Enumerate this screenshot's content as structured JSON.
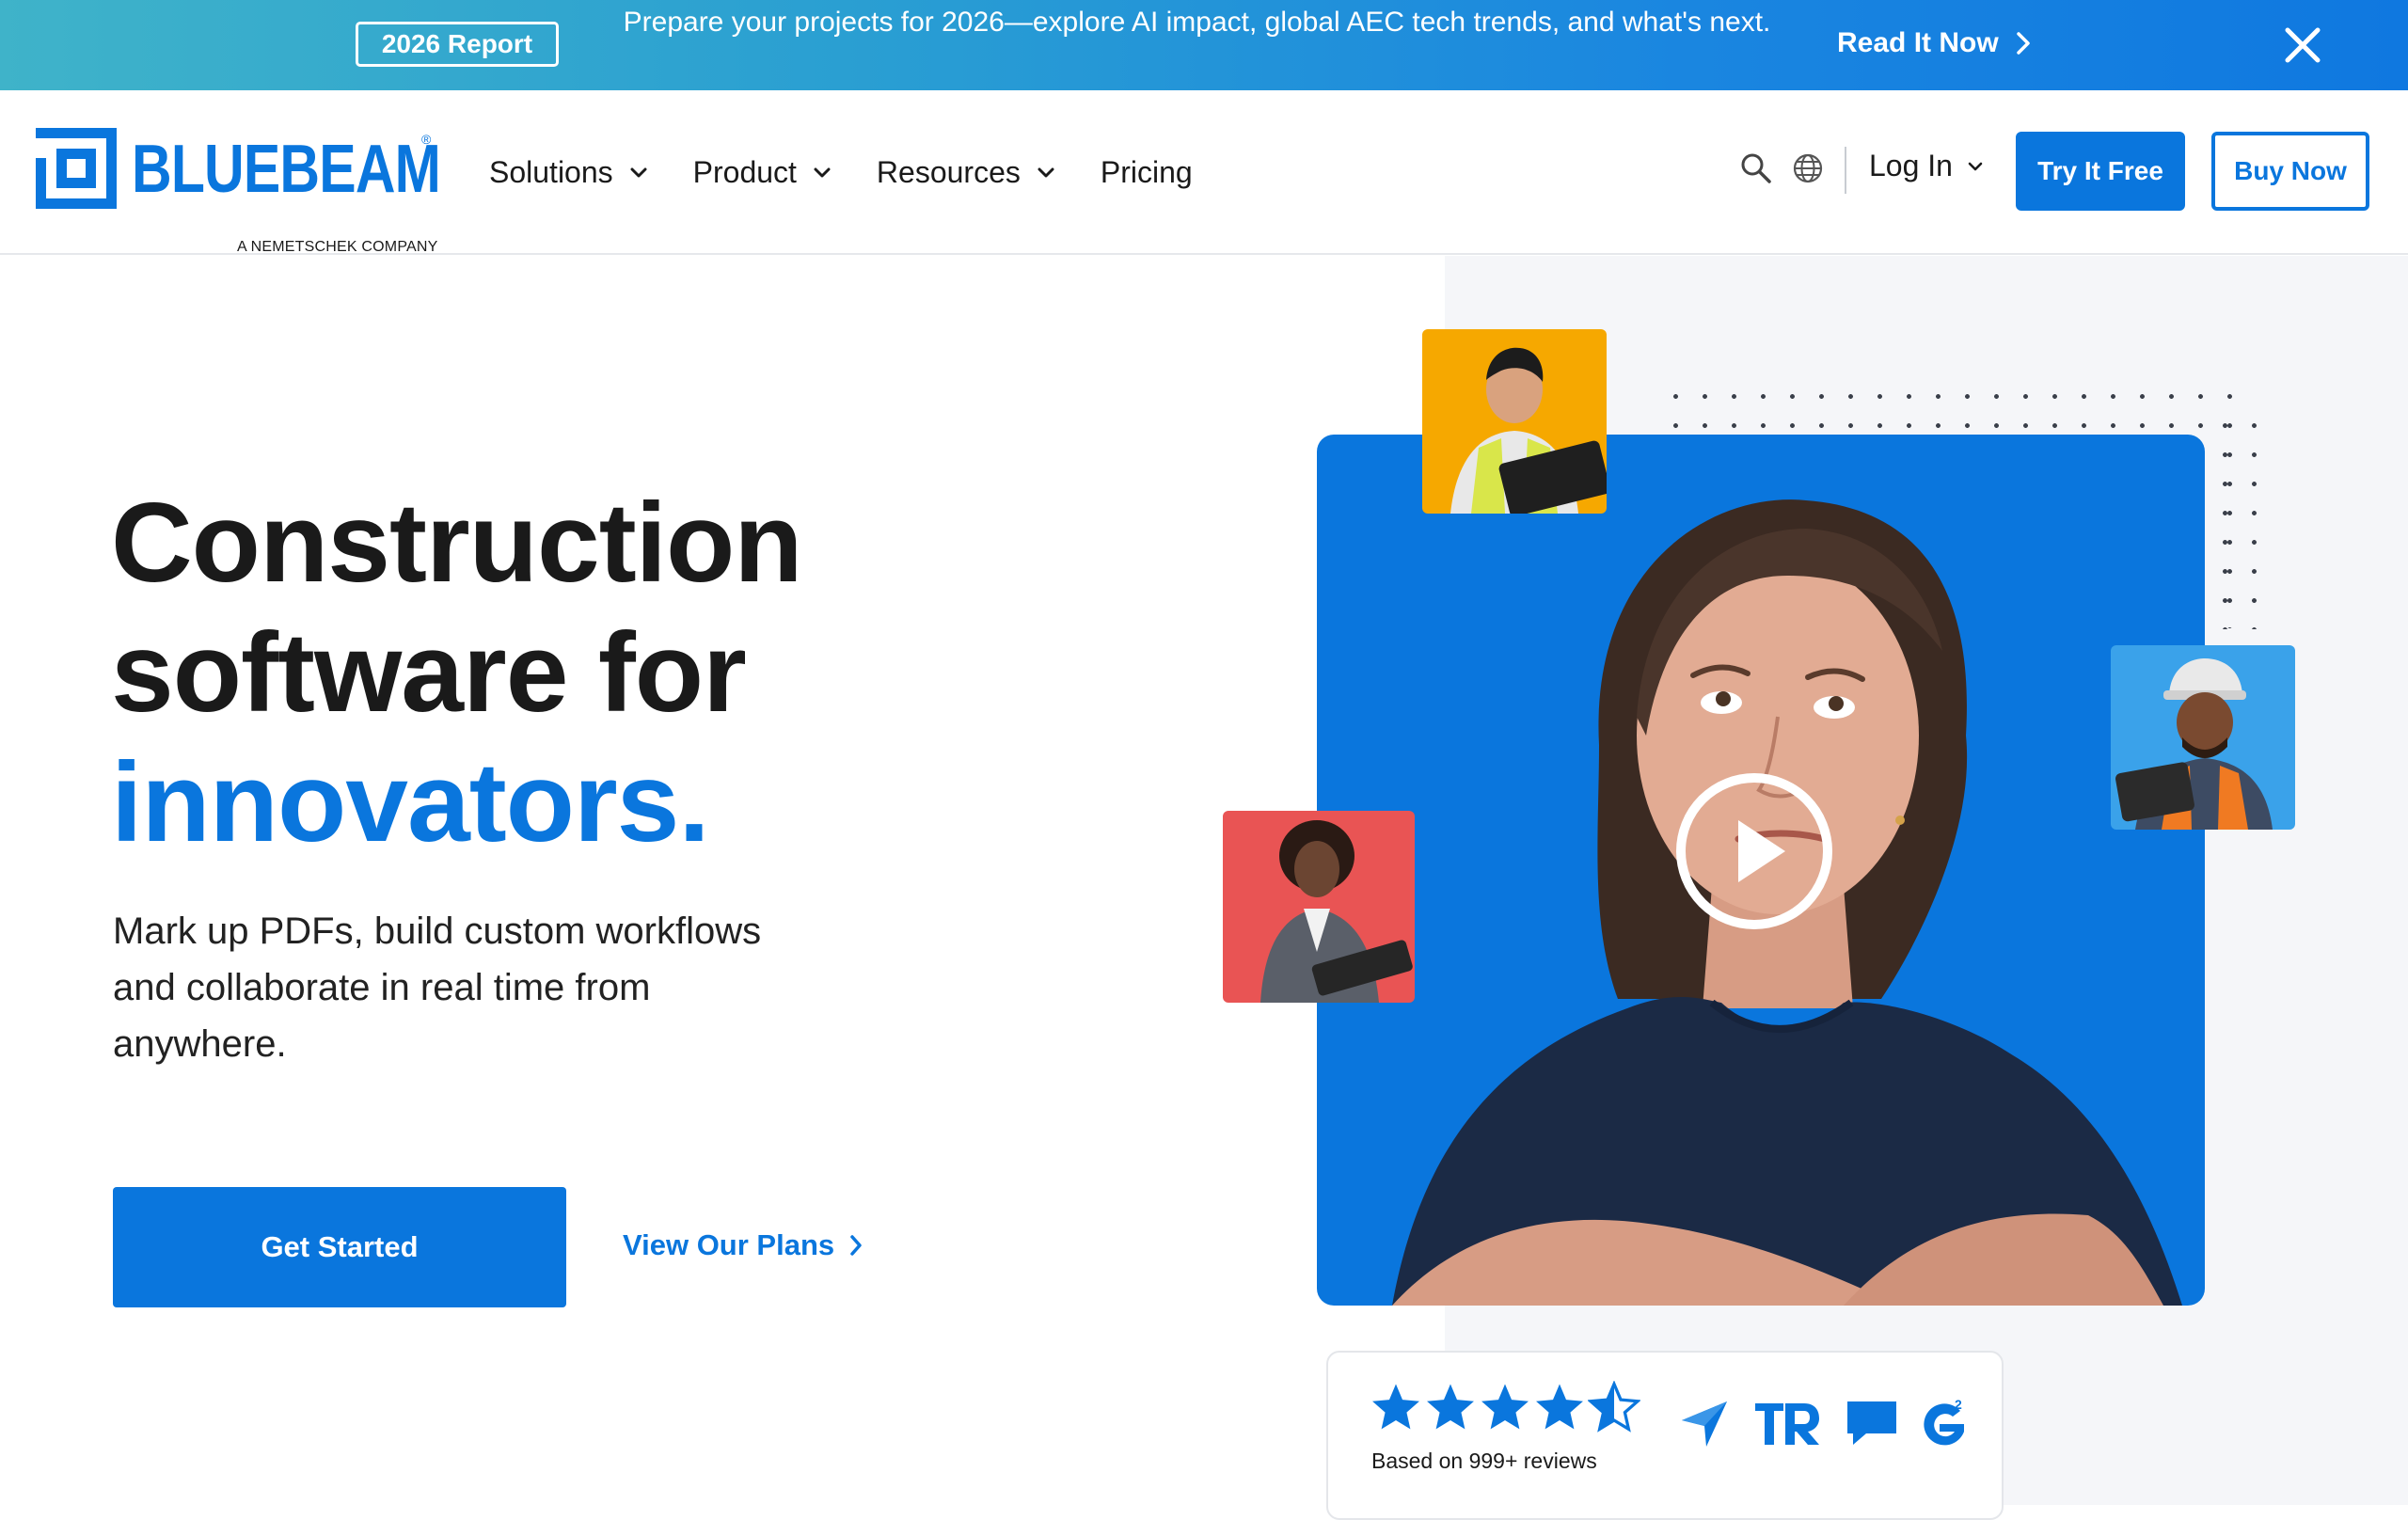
{
  "promo": {
    "badge": "2026 Report",
    "text": "Prepare your projects for 2026—explore AI impact, global AEC tech trends, and what's next.",
    "link": "Read It Now"
  },
  "header": {
    "logo_word": "BLUEBEAM",
    "logo_reg": "®",
    "logo_sub": "A NEMETSCHEK COMPANY",
    "nav": [
      "Solutions",
      "Product",
      "Resources",
      "Pricing"
    ],
    "login": "Log In",
    "try_free": "Try It Free",
    "buy_now": "Buy Now"
  },
  "hero": {
    "headline_line1": "Construction",
    "headline_line2": "software for",
    "headline_accent": "innovators.",
    "subcopy": "Mark up PDFs, build custom workflows and collaborate in real time from anywhere.",
    "cta_primary": "Get Started",
    "cta_secondary": "View Our Plans"
  },
  "reviews": {
    "rating": 4.5,
    "text": "Based on 999+ reviews",
    "sources": [
      "capterra-icon",
      "trustradius-icon",
      "software-advice-icon",
      "g2-icon"
    ]
  },
  "colors": {
    "brand_blue": "#0a76dd",
    "promo_gradient_start": "#3fb3c9",
    "promo_gradient_end": "#0f78e0",
    "thumb_yellow": "#f6a800",
    "thumb_red": "#e95454",
    "thumb_blue": "#3aa2ea"
  }
}
